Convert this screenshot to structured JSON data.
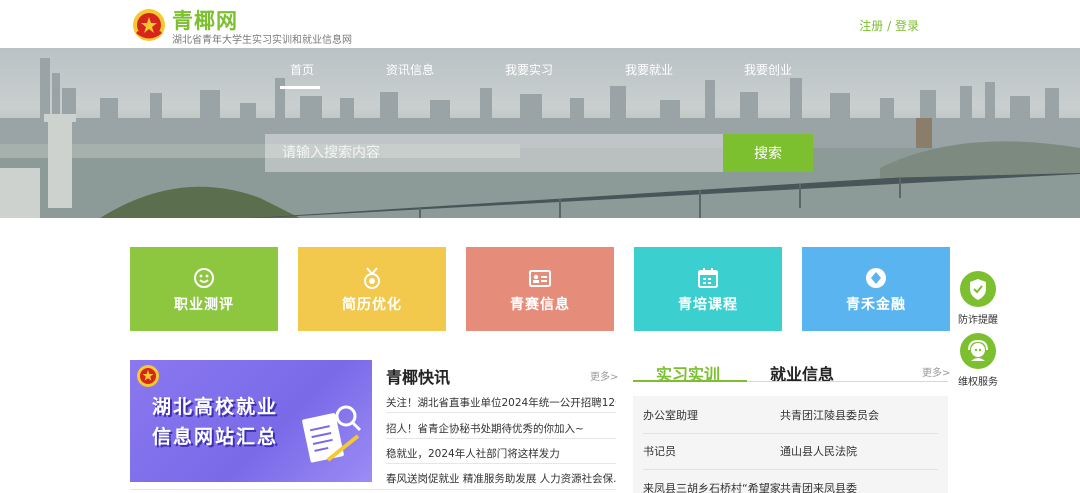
{
  "site": {
    "name": "青椰网",
    "subtitle": "湖北省青年大学生实习实训和就业信息网",
    "register": "注册",
    "separator": "/",
    "login": "登录"
  },
  "nav": {
    "items": [
      {
        "label": "首页",
        "active": true
      },
      {
        "label": "资讯信息"
      },
      {
        "label": "我要实习"
      },
      {
        "label": "我要就业"
      },
      {
        "label": "我要创业"
      }
    ]
  },
  "search": {
    "placeholder": "请输入搜索内容",
    "button": "搜索"
  },
  "tiles": [
    {
      "label": "职业测评",
      "color": "#8dc63f",
      "icon": "smile-icon"
    },
    {
      "label": "简历优化",
      "color": "#f2c94c",
      "icon": "medal-icon"
    },
    {
      "label": "青赛信息",
      "color": "#e58d7a",
      "icon": "id-card-icon"
    },
    {
      "label": "青培课程",
      "color": "#3ccfcf",
      "icon": "calendar-icon"
    },
    {
      "label": "青禾金融",
      "color": "#5ab4f0",
      "icon": "diamond-icon"
    }
  ],
  "side": {
    "fraud": "防诈提醒",
    "rights": "维权服务"
  },
  "promo": {
    "line1": "湖北高校就业",
    "line2": "信息网站汇总"
  },
  "news": {
    "title": "青椰快讯",
    "more": "更多>",
    "items": [
      "关注！湖北省直事业单位2024年统一公开招聘120...",
      "招人！省青企协秘书处期待优秀的你加入~",
      "稳就业，2024年人社部门将这样发力",
      "春风送岗促就业 精准服务助发展 人力资源社会保..."
    ]
  },
  "jobs": {
    "tab_internship": "实习实训",
    "tab_employment": "就业信息",
    "more": "更多>",
    "rows": [
      {
        "title": "办公室助理",
        "org": "共青团江陵县委员会"
      },
      {
        "title": "书记员",
        "org": "通山县人民法院"
      },
      {
        "title": "来凤县三胡乡石桥村“希望家",
        "org": "共青团来凤县委"
      }
    ]
  },
  "colors": {
    "accent": "#7cbf2f",
    "promo": "#7a6ae8"
  }
}
